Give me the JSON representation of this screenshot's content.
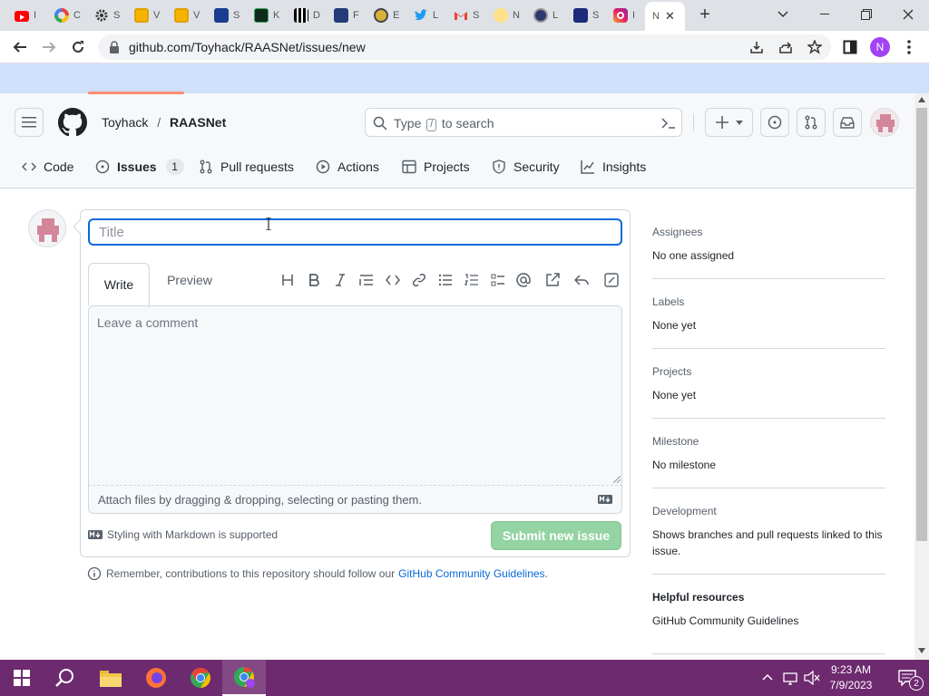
{
  "browser": {
    "tabs": [
      {
        "title": "I",
        "icon": "youtube-icon"
      },
      {
        "title": "C",
        "icon": "google-icon"
      },
      {
        "title": "S",
        "icon": "settings-gear-icon"
      },
      {
        "title": "V",
        "icon": "folder-icon"
      },
      {
        "title": "V",
        "icon": "folder-icon"
      },
      {
        "title": "S",
        "icon": "app-icon"
      },
      {
        "title": "K",
        "icon": "kim-icon"
      },
      {
        "title": "D",
        "icon": "qr-icon"
      },
      {
        "title": "F",
        "icon": "app-icon"
      },
      {
        "title": "E",
        "icon": "app-icon"
      },
      {
        "title": "L",
        "icon": "twitter-icon"
      },
      {
        "title": "S",
        "icon": "gmail-icon"
      },
      {
        "title": "N",
        "icon": "bulb-icon"
      },
      {
        "title": "L",
        "icon": "app-icon"
      },
      {
        "title": "S",
        "icon": "app-icon"
      },
      {
        "title": "I",
        "icon": "instagram-icon"
      }
    ],
    "active_tab_title": "N",
    "url": "github.com/Toyhack/RAASNet/issues/new",
    "profile_initial": "N"
  },
  "github": {
    "owner": "Toyhack",
    "separator": "/",
    "repo": "RAASNet",
    "search_placeholder_prefix": "Type",
    "search_key": "/",
    "search_placeholder_suffix": "to search",
    "nav": {
      "code": "Code",
      "issues": "Issues",
      "issues_count": "1",
      "pulls": "Pull requests",
      "actions": "Actions",
      "projects": "Projects",
      "security": "Security",
      "insights": "Insights"
    }
  },
  "issue_form": {
    "title_placeholder": "Title",
    "title_value": "",
    "tab_write": "Write",
    "tab_preview": "Preview",
    "comment_placeholder": "Leave a comment",
    "attach_text": "Attach files by dragging & dropping, selecting or pasting them.",
    "markdown_note": "Styling with Markdown is supported",
    "submit_label": "Submit new issue",
    "remember_text": "Remember, contributions to this repository should follow our",
    "remember_link": "GitHub Community Guidelines",
    "remember_end": "."
  },
  "sidebar": {
    "assignees": {
      "heading": "Assignees",
      "value": "No one assigned"
    },
    "labels": {
      "heading": "Labels",
      "value": "None yet"
    },
    "projects": {
      "heading": "Projects",
      "value": "None yet"
    },
    "milestone": {
      "heading": "Milestone",
      "value": "No milestone"
    },
    "development": {
      "heading": "Development",
      "value": "Shows branches and pull requests linked to this issue."
    },
    "helpful": {
      "heading": "Helpful resources",
      "link": "GitHub Community Guidelines"
    }
  },
  "taskbar": {
    "time": "9:23 AM",
    "date": "7/9/2023",
    "notifications": "2"
  }
}
